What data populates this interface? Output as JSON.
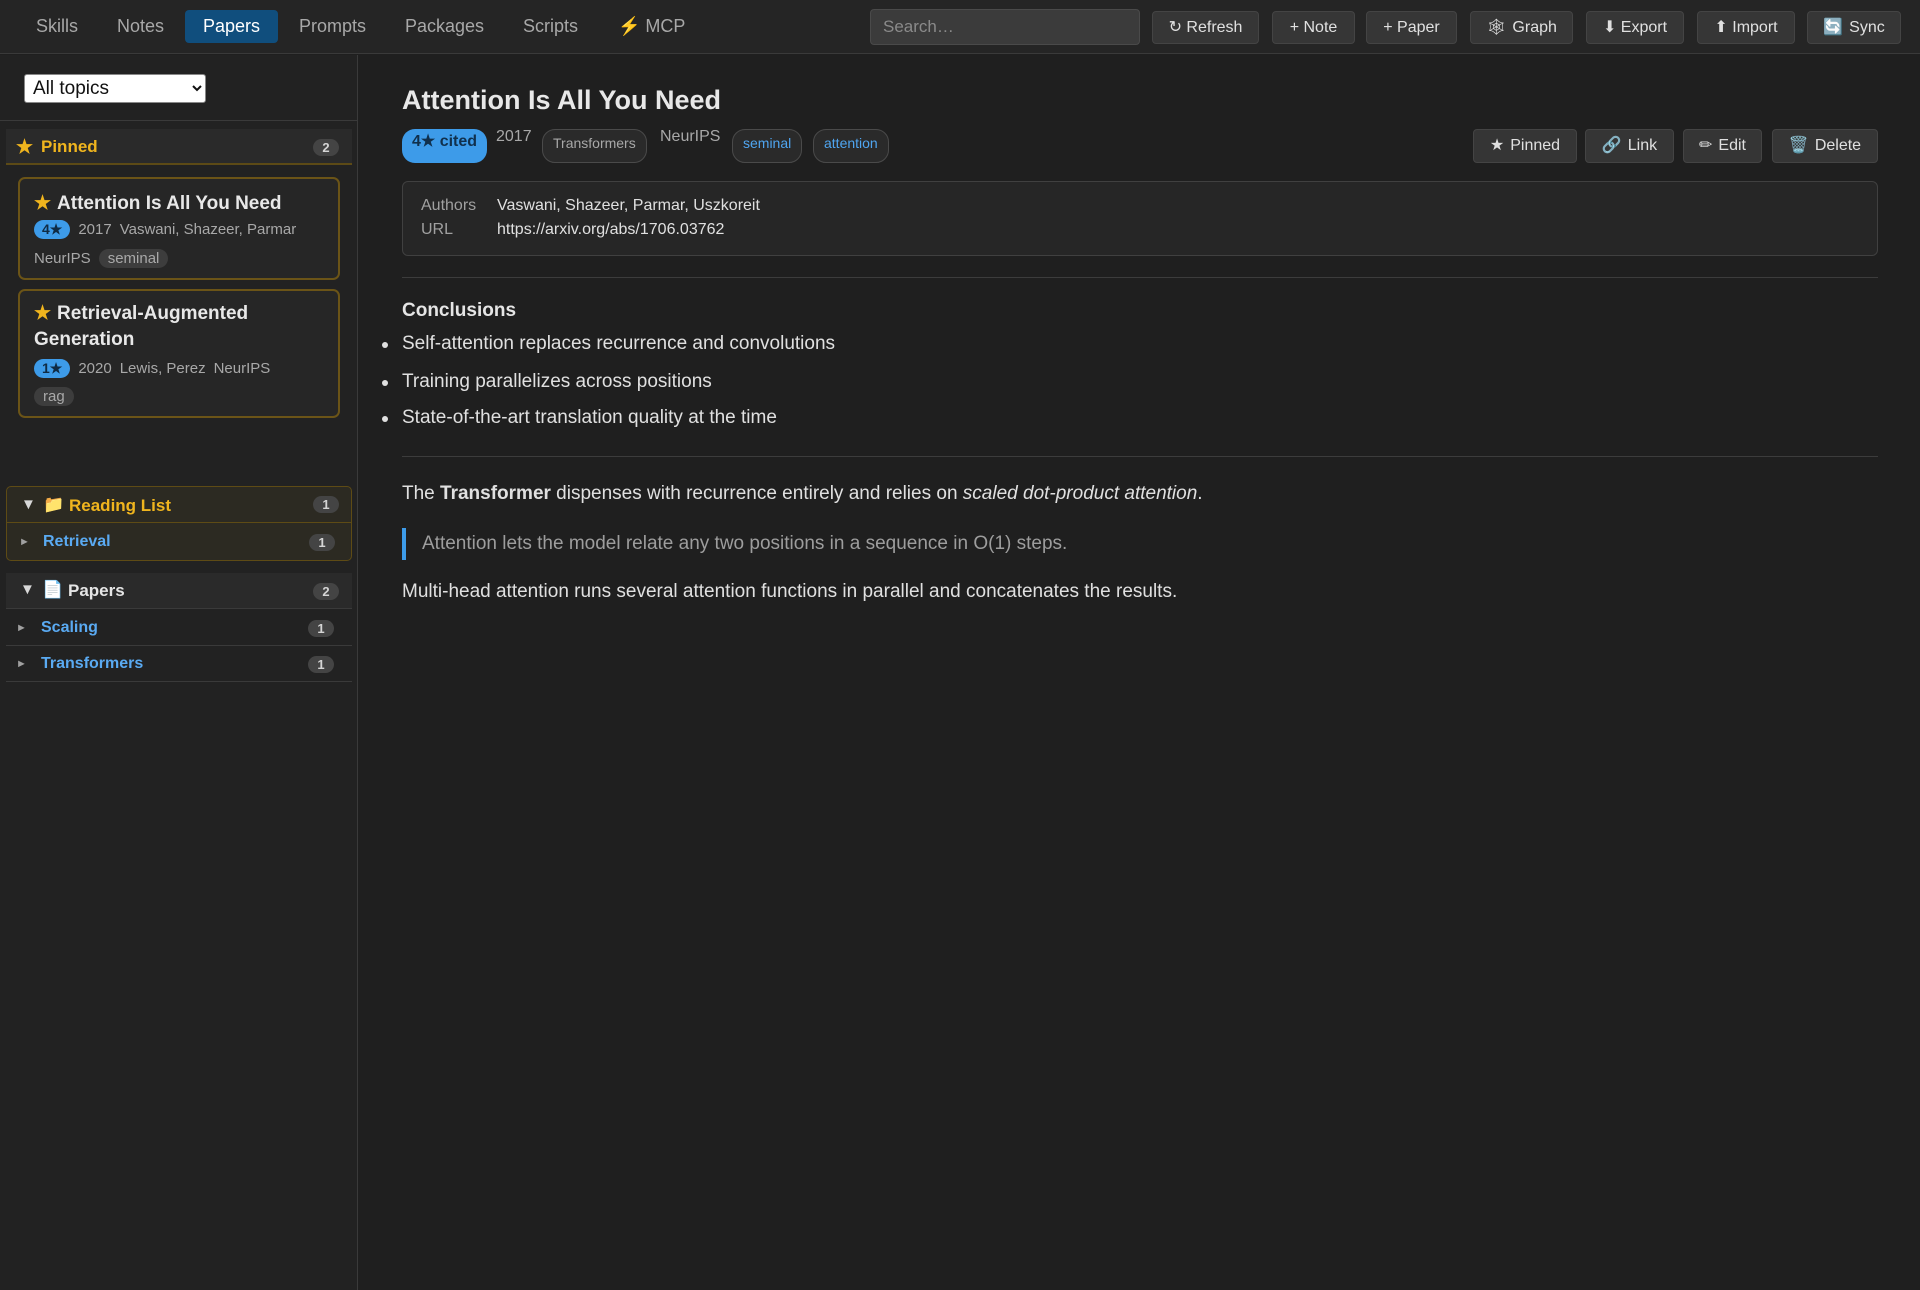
{
  "nav": {
    "tabs": [
      {
        "label": "Skills"
      },
      {
        "label": "Notes"
      },
      {
        "label": "Papers"
      },
      {
        "label": "Prompts"
      },
      {
        "label": "Packages"
      },
      {
        "label": "Scripts"
      },
      {
        "label": "⚡ MCP"
      }
    ],
    "active_tab": "Papers",
    "search_placeholder": "Search…",
    "buttons": {
      "refresh": "↻ Refresh",
      "note": "+ Note",
      "paper": "+ Paper",
      "graph": "Graph",
      "export": "⬇ Export",
      "import": "⬆ Import",
      "sync": "Sync"
    }
  },
  "sidebar": {
    "topic_filter": {
      "selected": "All topics",
      "options": [
        "All topics"
      ]
    },
    "pinned": {
      "label": "Pinned",
      "count": "2",
      "items": [
        {
          "title": "Attention Is All You Need",
          "cited": "4★",
          "year": "2017",
          "authors": "Vaswani, Shazeer, Parmar",
          "venue": "NeurIPS",
          "tag": "seminal"
        },
        {
          "title": "Retrieval-Augmented Generation",
          "cited": "1★",
          "year": "2020",
          "authors": "Lewis, Perez",
          "venue": "NeurIPS",
          "tag": "rag"
        }
      ]
    },
    "reading_list": {
      "label": "Reading List",
      "count": "1",
      "items": [
        {
          "label": "Retrieval",
          "count": "1"
        }
      ]
    },
    "papers": {
      "label": "Papers",
      "count": "2",
      "items": [
        {
          "label": "Scaling",
          "count": "1"
        },
        {
          "label": "Transformers",
          "count": "1"
        }
      ]
    }
  },
  "paper": {
    "title": "Attention Is All You Need",
    "cited_badge": "4★ cited",
    "year": "2017",
    "topic": "Transformers",
    "venue": "NeurIPS",
    "tags": [
      "seminal",
      "attention"
    ],
    "actions": {
      "pinned": "Pinned",
      "link": "Link",
      "edit": "Edit",
      "delete": "Delete"
    },
    "info": {
      "authors_label": "Authors",
      "authors": "Vaswani, Shazeer, Parmar, Uszkoreit",
      "url_label": "URL",
      "url": "https://arxiv.org/abs/1706.03762"
    },
    "conclusions_heading": "Conclusions",
    "conclusions": [
      "Self-attention replaces recurrence and convolutions",
      "Training parallelizes across positions",
      "State-of-the-art translation quality at the time"
    ],
    "body": {
      "p1_a": "The ",
      "p1_bold": "Transformer",
      "p1_b": " dispenses with recurrence entirely and relies on ",
      "p1_italic": "scaled dot-product attention",
      "p1_c": ".",
      "quote": "Attention lets the model relate any two positions in a sequence in O(1) steps.",
      "p2": "Multi-head attention runs several attention functions in parallel and concatenates the results."
    }
  },
  "colors": {
    "accent": "#3d9be9",
    "active_tab": "#104e7d",
    "pinned": "#f0b51e",
    "link": "#5aaaf2"
  }
}
